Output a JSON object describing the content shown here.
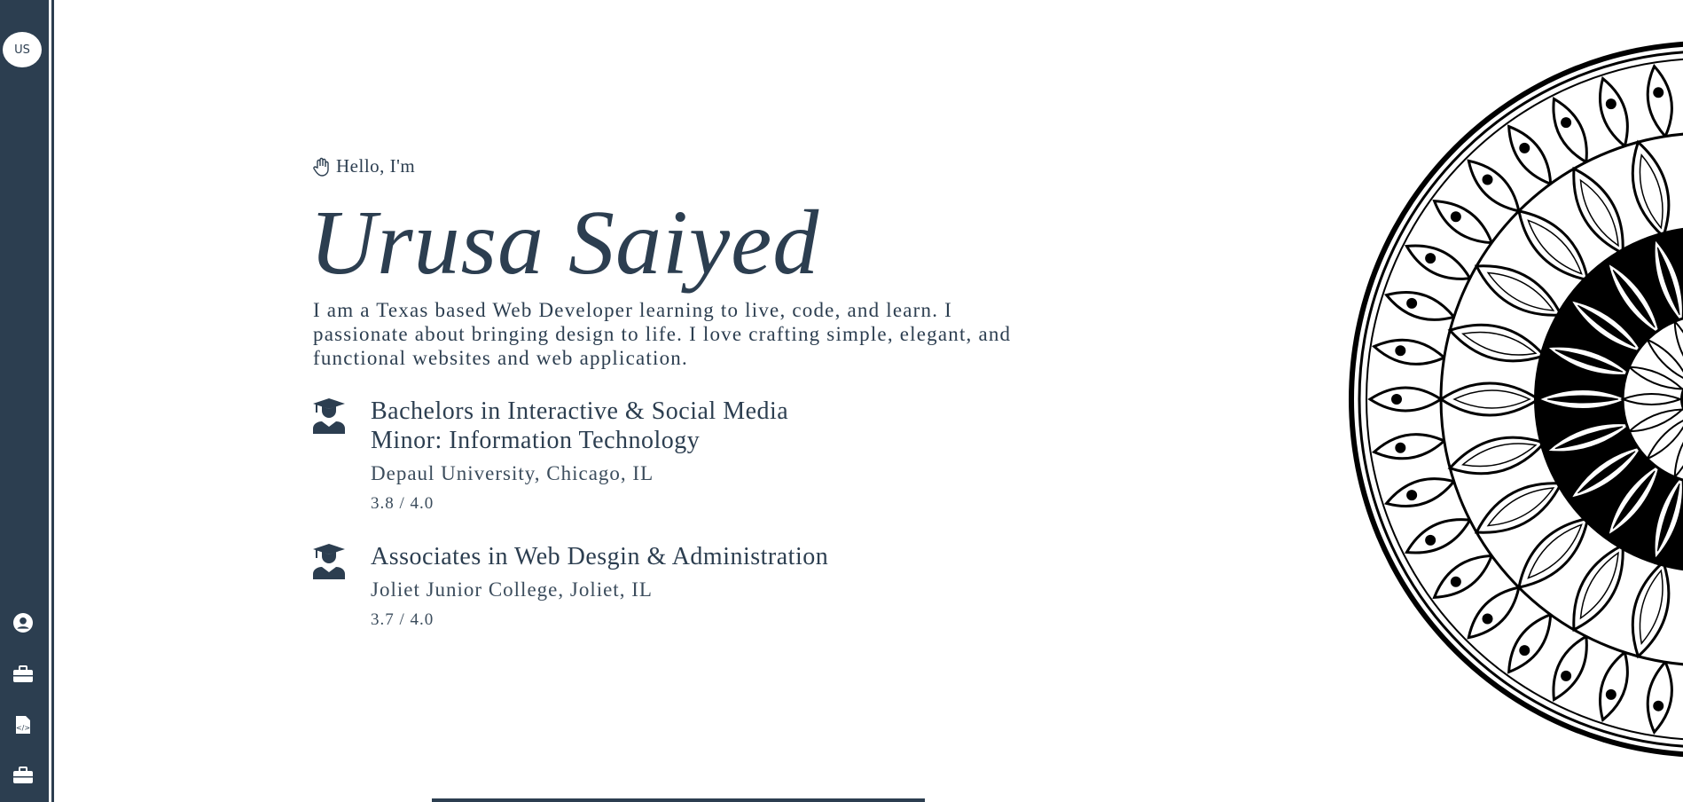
{
  "sidebar": {
    "avatar_initials": "US",
    "nav_items": [
      {
        "icon": "user-circle-icon",
        "label": "About"
      },
      {
        "icon": "briefcase-icon",
        "label": "Experience"
      },
      {
        "icon": "code-file-icon",
        "label": "Projects"
      },
      {
        "icon": "briefcase-icon",
        "label": "Work"
      }
    ],
    "color": "#2c3e50"
  },
  "intro": {
    "greeting_icon": "hand-wave-icon",
    "greeting": "Hello, I'm",
    "name": "Urusa Saiyed",
    "bio": "I am a Texas based Web Developer learning to live, code, and learn. I passionate about bringing design to life. I love crafting simple, elegant, and functional websites and web application."
  },
  "education": [
    {
      "icon": "graduate-icon",
      "degree_line1": "Bachelors in Interactive & Social Media",
      "degree_line2": "Minor: Information Technology",
      "school": "Depaul University, Chicago, IL",
      "gpa": "3.8 / 4.0"
    },
    {
      "icon": "graduate-icon",
      "degree_line1": "Associates in Web Desgin & Administration",
      "degree_line2": "",
      "school": "Joliet Junior College, Joliet, IL",
      "gpa": "3.7 / 4.0"
    }
  ],
  "colors": {
    "primary": "#2c3e50",
    "background": "#ffffff"
  }
}
